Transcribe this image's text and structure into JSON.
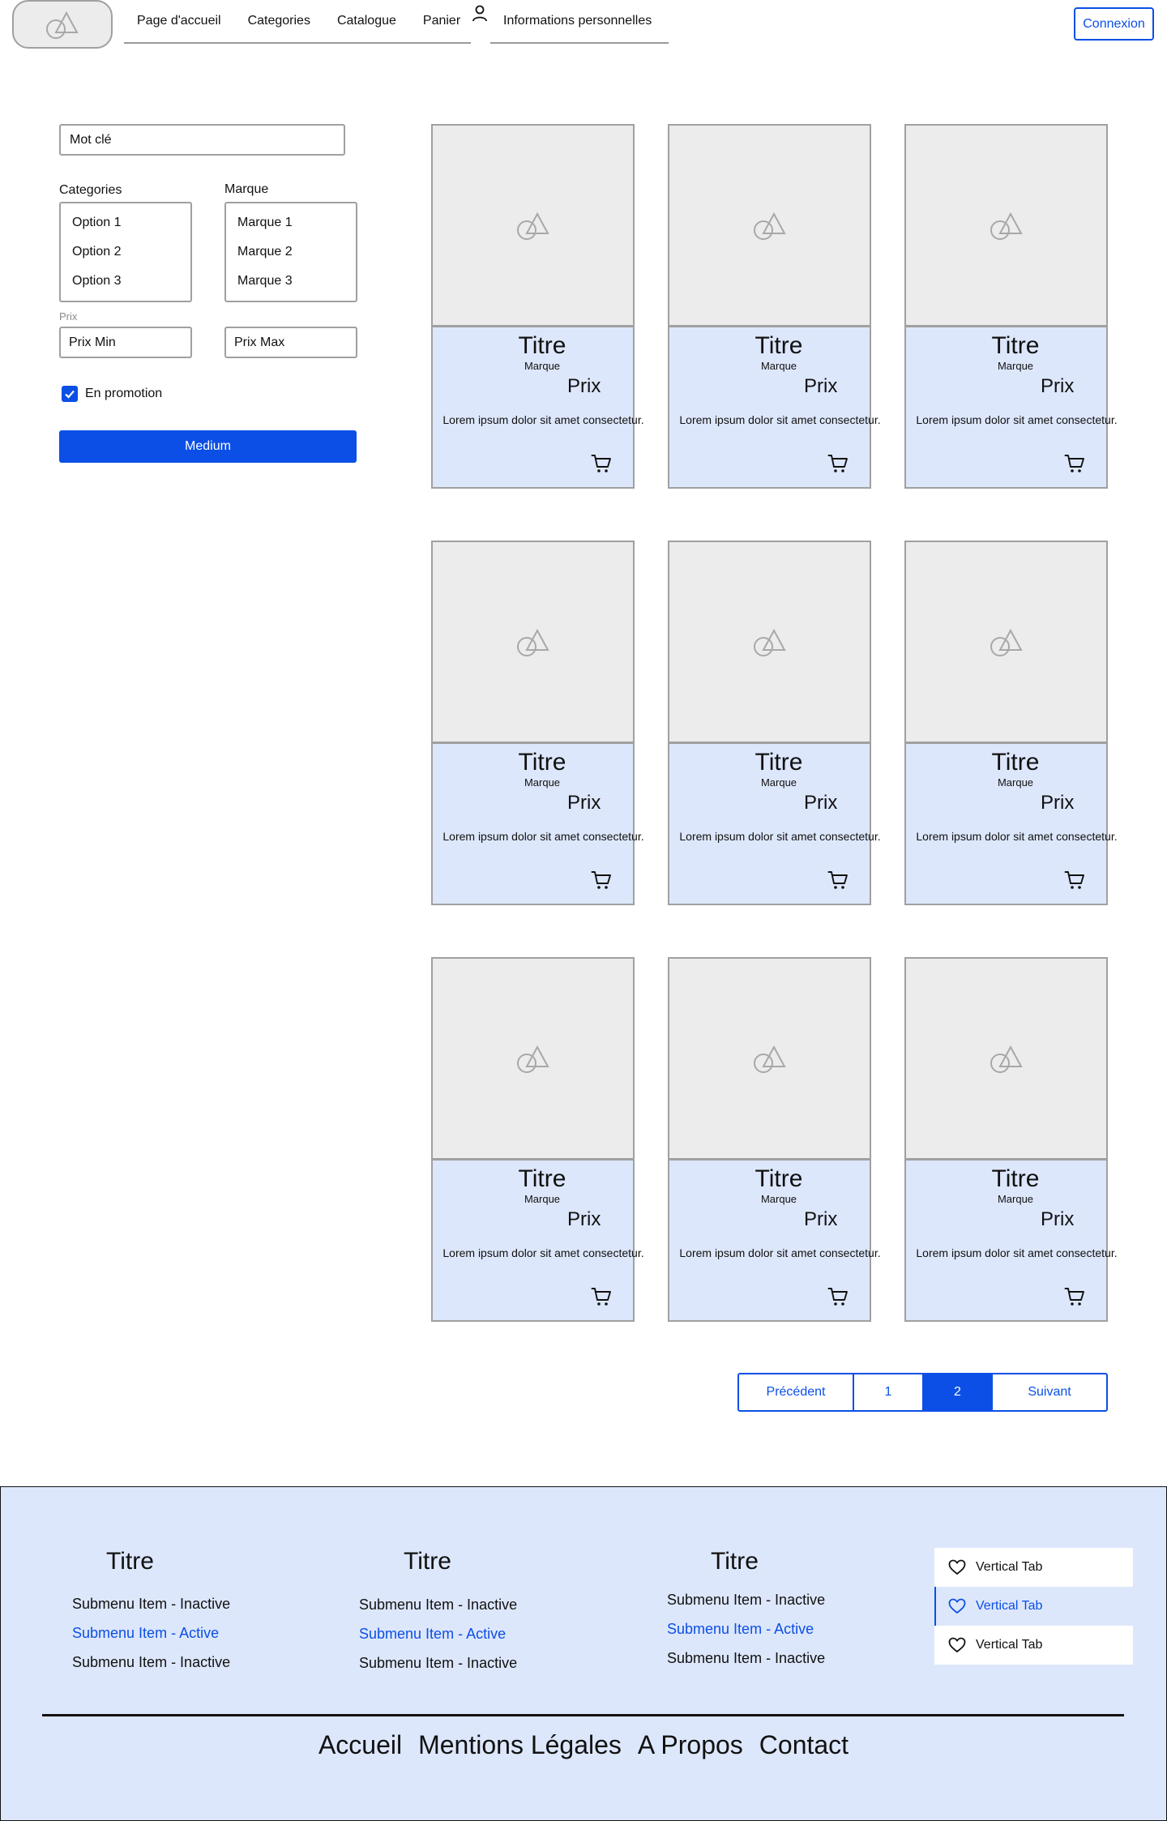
{
  "header": {
    "logo_icon": "image-placeholder-icon",
    "nav": {
      "home": "Page d'accueil",
      "categories": "Categories",
      "catalogue": "Catalogue",
      "cart": "Panier",
      "personal": "Informations personnelles"
    },
    "user_icon": "user-icon",
    "login": "Connexion"
  },
  "filters": {
    "keyword_value": "Mot clé",
    "categories_label": "Categories",
    "categories_options": [
      "Option 1",
      "Option 2",
      "Option 3"
    ],
    "brand_label": "Marque",
    "brand_options": [
      "Marque 1",
      "Marque 2",
      "Marque 3"
    ],
    "price_label": "Prix",
    "price_min": "Prix Min",
    "price_max": "Prix Max",
    "promo_label": "En promotion",
    "promo_checked": true,
    "submit_label": "Medium"
  },
  "products": [
    {
      "title": "Titre",
      "brand": "Marque",
      "price": "Prix",
      "description": "Lorem ipsum dolor sit amet consectetur."
    },
    {
      "title": "Titre",
      "brand": "Marque",
      "price": "Prix",
      "description": "Lorem ipsum dolor sit amet consectetur."
    },
    {
      "title": "Titre",
      "brand": "Marque",
      "price": "Prix",
      "description": "Lorem ipsum dolor sit amet consectetur."
    },
    {
      "title": "Titre",
      "brand": "Marque",
      "price": "Prix",
      "description": "Lorem ipsum dolor sit amet consectetur."
    },
    {
      "title": "Titre",
      "brand": "Marque",
      "price": "Prix",
      "description": "Lorem ipsum dolor sit amet consectetur."
    },
    {
      "title": "Titre",
      "brand": "Marque",
      "price": "Prix",
      "description": "Lorem ipsum dolor sit amet consectetur."
    },
    {
      "title": "Titre",
      "brand": "Marque",
      "price": "Prix",
      "description": "Lorem ipsum dolor sit amet consectetur."
    },
    {
      "title": "Titre",
      "brand": "Marque",
      "price": "Prix",
      "description": "Lorem ipsum dolor sit amet consectetur."
    },
    {
      "title": "Titre",
      "brand": "Marque",
      "price": "Prix",
      "description": "Lorem ipsum dolor sit amet consectetur."
    }
  ],
  "pagination": {
    "prev": "Précédent",
    "pages": [
      "1",
      "2"
    ],
    "current": "2",
    "next": "Suivant"
  },
  "footer": {
    "columns": [
      {
        "title": "Titre",
        "items": [
          {
            "label": "Submenu Item - Inactive",
            "active": false
          },
          {
            "label": "Submenu Item - Active",
            "active": true
          },
          {
            "label": "Submenu Item - Inactive",
            "active": false
          }
        ]
      },
      {
        "title": "Titre",
        "items": [
          {
            "label": "Submenu Item - Inactive",
            "active": false
          },
          {
            "label": "Submenu Item - Active",
            "active": true
          },
          {
            "label": "Submenu Item - Inactive",
            "active": false
          }
        ]
      },
      {
        "title": "Titre",
        "items": [
          {
            "label": "Submenu Item - Inactive",
            "active": false
          },
          {
            "label": "Submenu Item - Active",
            "active": true
          },
          {
            "label": "Submenu Item - Inactive",
            "active": false
          }
        ]
      }
    ],
    "vertical_tabs": [
      {
        "label": "Vertical Tab",
        "icon": "heart-icon",
        "active": false
      },
      {
        "label": "Vertical Tab",
        "icon": "heart-icon",
        "active": true
      },
      {
        "label": "Vertical Tab",
        "icon": "heart-icon",
        "active": false
      }
    ],
    "bottom_links": [
      "Accueil",
      "Mentions Légales",
      "A Propos",
      "Contact"
    ]
  },
  "colors": {
    "accent": "#0b4fe6",
    "card_bg": "#dde7fb",
    "placeholder_bg": "#ececec",
    "border": "#a0a0a0"
  }
}
